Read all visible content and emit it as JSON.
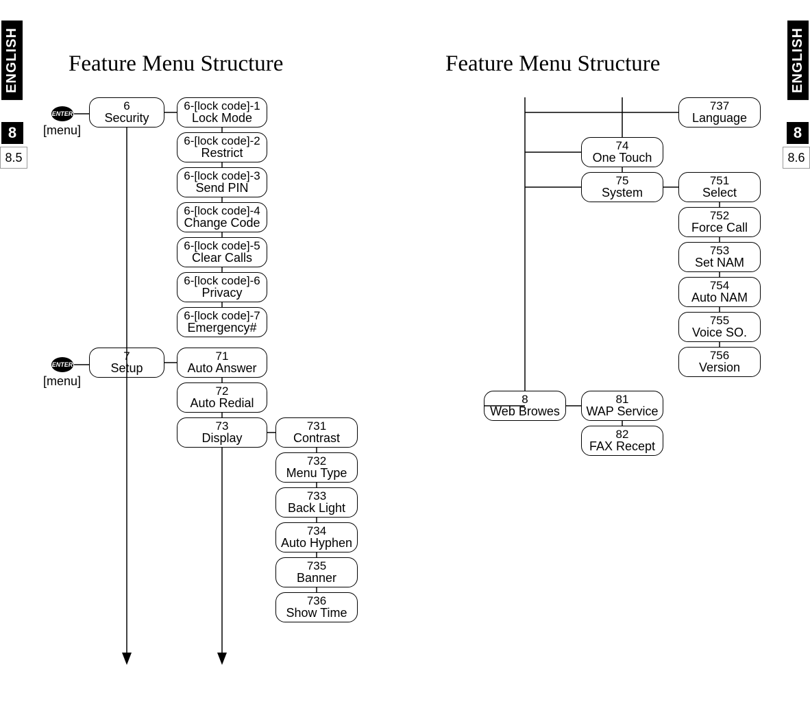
{
  "tabs": {
    "left": {
      "lang": "ENGLISH",
      "chapter": "8",
      "page": "8.5"
    },
    "right": {
      "lang": "ENGLISH",
      "chapter": "8",
      "page": "8.6"
    }
  },
  "headings": {
    "left": "Feature Menu Structure",
    "right": "Feature Menu Structure"
  },
  "menu_label": "[menu]",
  "enter_label": "ENTER",
  "left": {
    "security": {
      "code": "6",
      "label": "Security"
    },
    "security_children": [
      {
        "code": "6-[lock code]-1",
        "label": "Lock Mode"
      },
      {
        "code": "6-[lock code]-2",
        "label": "Restrict"
      },
      {
        "code": "6-[lock code]-3",
        "label": "Send PIN"
      },
      {
        "code": "6-[lock code]-4",
        "label": "Change Code"
      },
      {
        "code": "6-[lock code]-5",
        "label": "Clear Calls"
      },
      {
        "code": "6-[lock code]-6",
        "label": "Privacy"
      },
      {
        "code": "6-[lock code]-7",
        "label": "Emergency#"
      }
    ],
    "setup": {
      "code": "7",
      "label": "Setup"
    },
    "setup_children": [
      {
        "code": "71",
        "label": "Auto Answer"
      },
      {
        "code": "72",
        "label": "Auto Redial"
      },
      {
        "code": "73",
        "label": "Display"
      }
    ],
    "display_children": [
      {
        "code": "731",
        "label": "Contrast"
      },
      {
        "code": "732",
        "label": "Menu Type"
      },
      {
        "code": "733",
        "label": "Back Light"
      },
      {
        "code": "734",
        "label": "Auto Hyphen"
      },
      {
        "code": "735",
        "label": "Banner"
      },
      {
        "code": "736",
        "label": "Show Time"
      }
    ]
  },
  "right": {
    "language": {
      "code": "737",
      "label": "Language"
    },
    "one_touch": {
      "code": "74",
      "label": "One Touch"
    },
    "system": {
      "code": "75",
      "label": "System"
    },
    "system_children": [
      {
        "code": "751",
        "label": "Select"
      },
      {
        "code": "752",
        "label": "Force Call"
      },
      {
        "code": "753",
        "label": "Set NAM"
      },
      {
        "code": "754",
        "label": "Auto NAM"
      },
      {
        "code": "755",
        "label": "Voice SO."
      },
      {
        "code": "756",
        "label": "Version"
      }
    ],
    "web": {
      "code": "8",
      "label": "Web Browes"
    },
    "web_children": [
      {
        "code": "81",
        "label": "WAP Service"
      },
      {
        "code": "82",
        "label": "FAX Recept"
      }
    ]
  }
}
